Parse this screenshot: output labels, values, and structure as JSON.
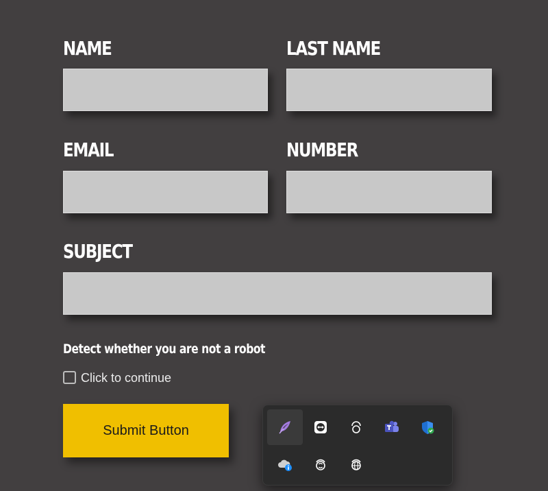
{
  "form": {
    "name_label": "NAME",
    "last_name_label": "LAST NAME",
    "email_label": "EMAIL",
    "number_label": "NUMBER",
    "subject_label": "SUBJECT",
    "robot_heading": "Detect whether you are not a robot",
    "checkbox_label": "Click to continue",
    "submit_label": "Submit Button"
  },
  "tray": {
    "icons": [
      "feather-icon",
      "teamviewer-icon",
      "headset-icon",
      "teams-icon",
      "security-shield-icon",
      "cloud-info-icon",
      "sync-icon",
      "vpn-globe-icon"
    ]
  },
  "colors": {
    "background": "#423f40",
    "field": "#c8c8c8",
    "submit": "#f0bf00",
    "tray": "#2b2b2b"
  }
}
